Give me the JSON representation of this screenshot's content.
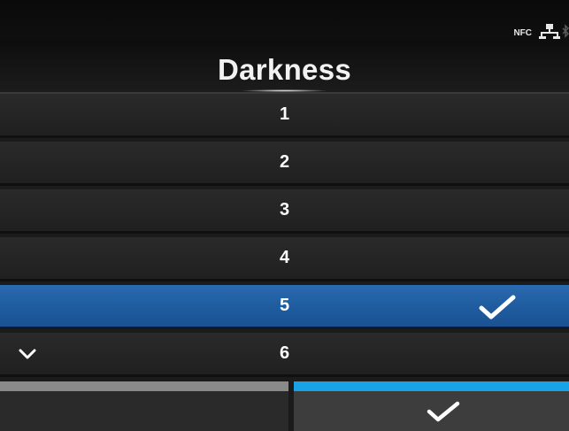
{
  "header": {
    "title": "Darkness",
    "status_icons": {
      "nfc_label": "NFC",
      "nfc_waves": "⸨",
      "network_icon": "network-icon",
      "bluetooth_icon": "bluetooth-icon",
      "bluetooth_glyph": "ᚼ"
    }
  },
  "list": {
    "items": [
      {
        "label": "1",
        "selected": false
      },
      {
        "label": "2",
        "selected": false
      },
      {
        "label": "3",
        "selected": false
      },
      {
        "label": "4",
        "selected": false
      },
      {
        "label": "5",
        "selected": true
      },
      {
        "label": "6",
        "selected": false
      }
    ],
    "scroll_indicator": "chevron-down-icon"
  },
  "footer": {
    "cancel_icon": "none",
    "ok_icon": "checkmark-icon"
  },
  "colors": {
    "selected_row": "#1f5da0",
    "accent": "#18a3e8",
    "cancel_bar": "#8a8a8a"
  }
}
